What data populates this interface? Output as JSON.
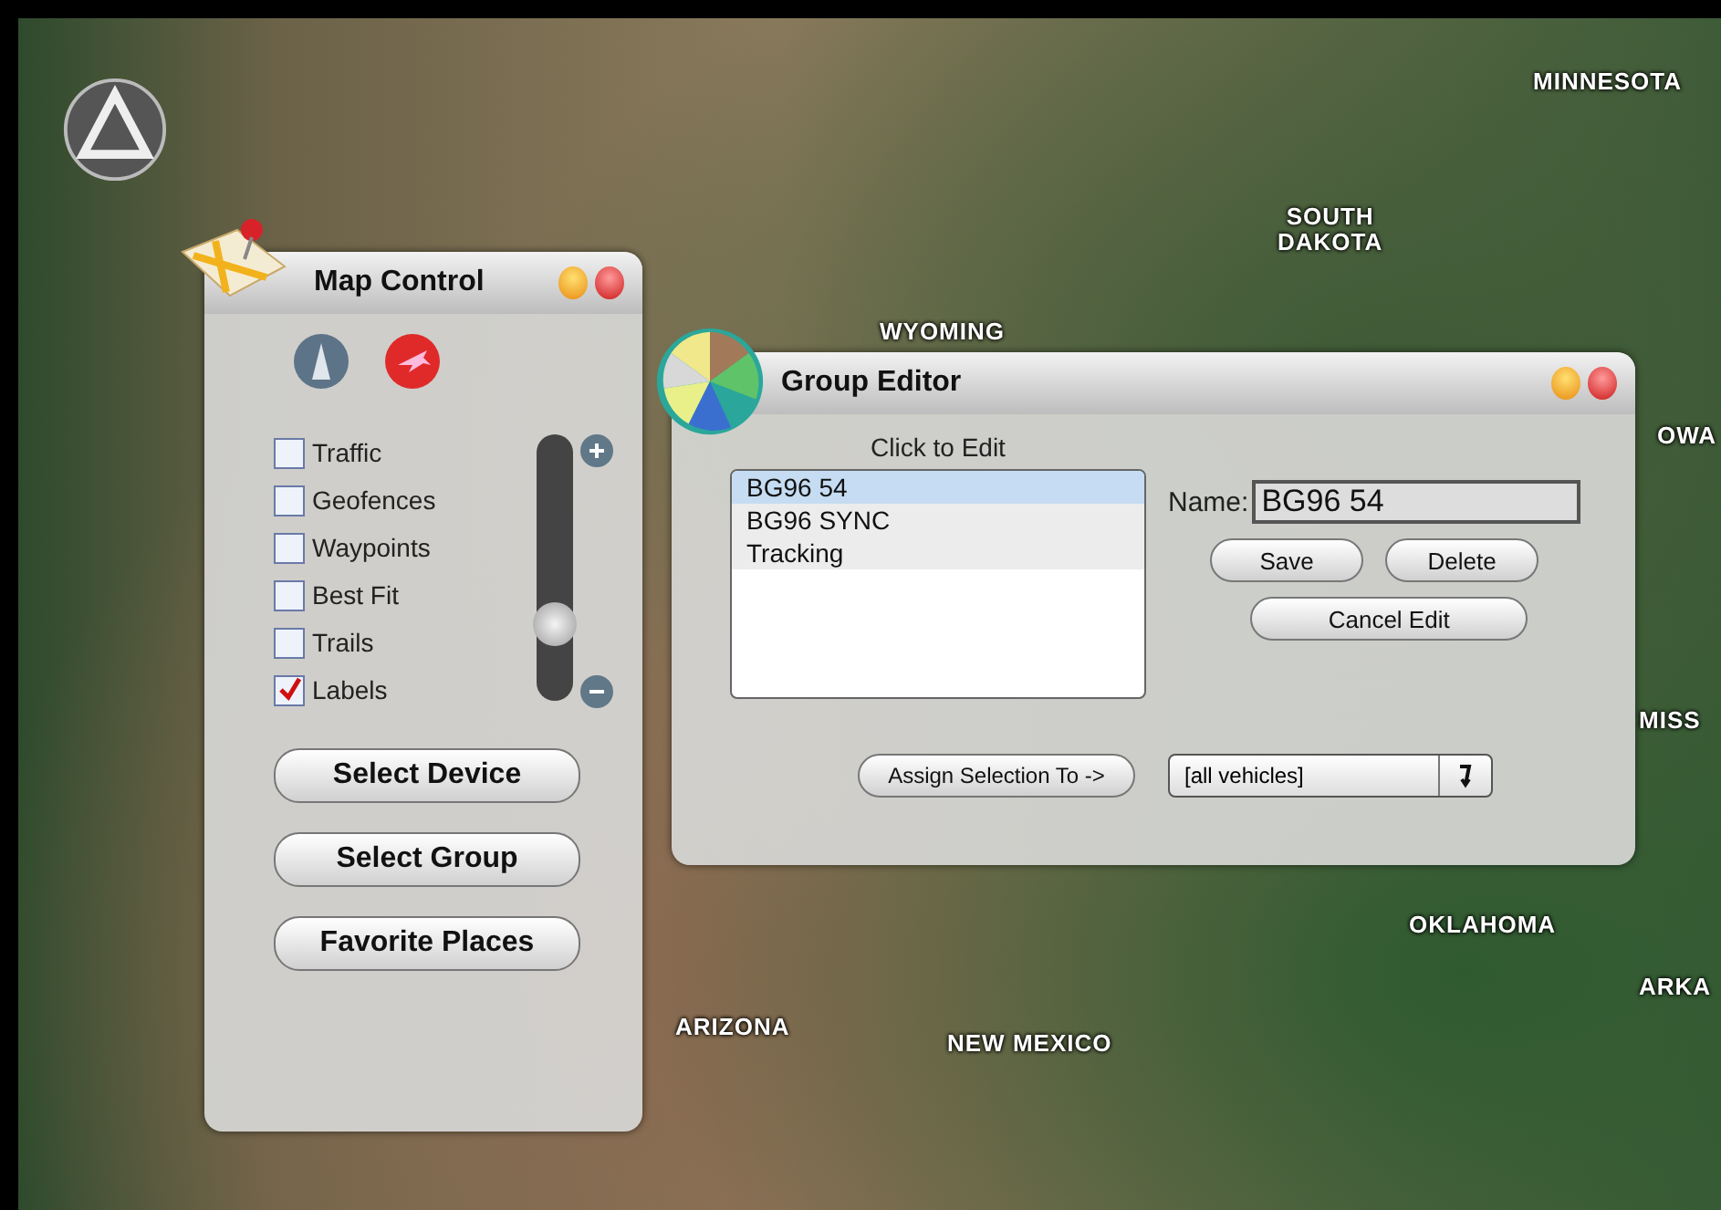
{
  "map_labels": [
    "MINNESOTA",
    "SOUTH\nDAKOTA",
    "WYOMING",
    "OWA",
    "MISS",
    "OKLAHOMA",
    "ARKA",
    "ARIZONA",
    "NEW MEXICO"
  ],
  "map_control": {
    "title": "Map Control",
    "layers": [
      {
        "label": "Traffic",
        "checked": false
      },
      {
        "label": "Geofences",
        "checked": false
      },
      {
        "label": "Waypoints",
        "checked": false
      },
      {
        "label": "Best Fit",
        "checked": false
      },
      {
        "label": "Trails",
        "checked": false
      },
      {
        "label": "Labels",
        "checked": true
      }
    ],
    "zoom": {
      "level": 0.25
    },
    "buttons": [
      "Select Device",
      "Select Group",
      "Favorite Places"
    ]
  },
  "group_editor": {
    "title": "Group Editor",
    "list_heading": "Click to Edit",
    "groups": [
      {
        "label": "BG96 54",
        "selected": true
      },
      {
        "label": "BG96 SYNC",
        "selected": false
      },
      {
        "label": "Tracking",
        "selected": false
      }
    ],
    "name_label": "Name:",
    "name_value": "BG96 54",
    "save": "Save",
    "delete": "Delete",
    "cancel": "Cancel Edit",
    "assign": "Assign Selection To ->",
    "target": "[all vehicles]"
  }
}
